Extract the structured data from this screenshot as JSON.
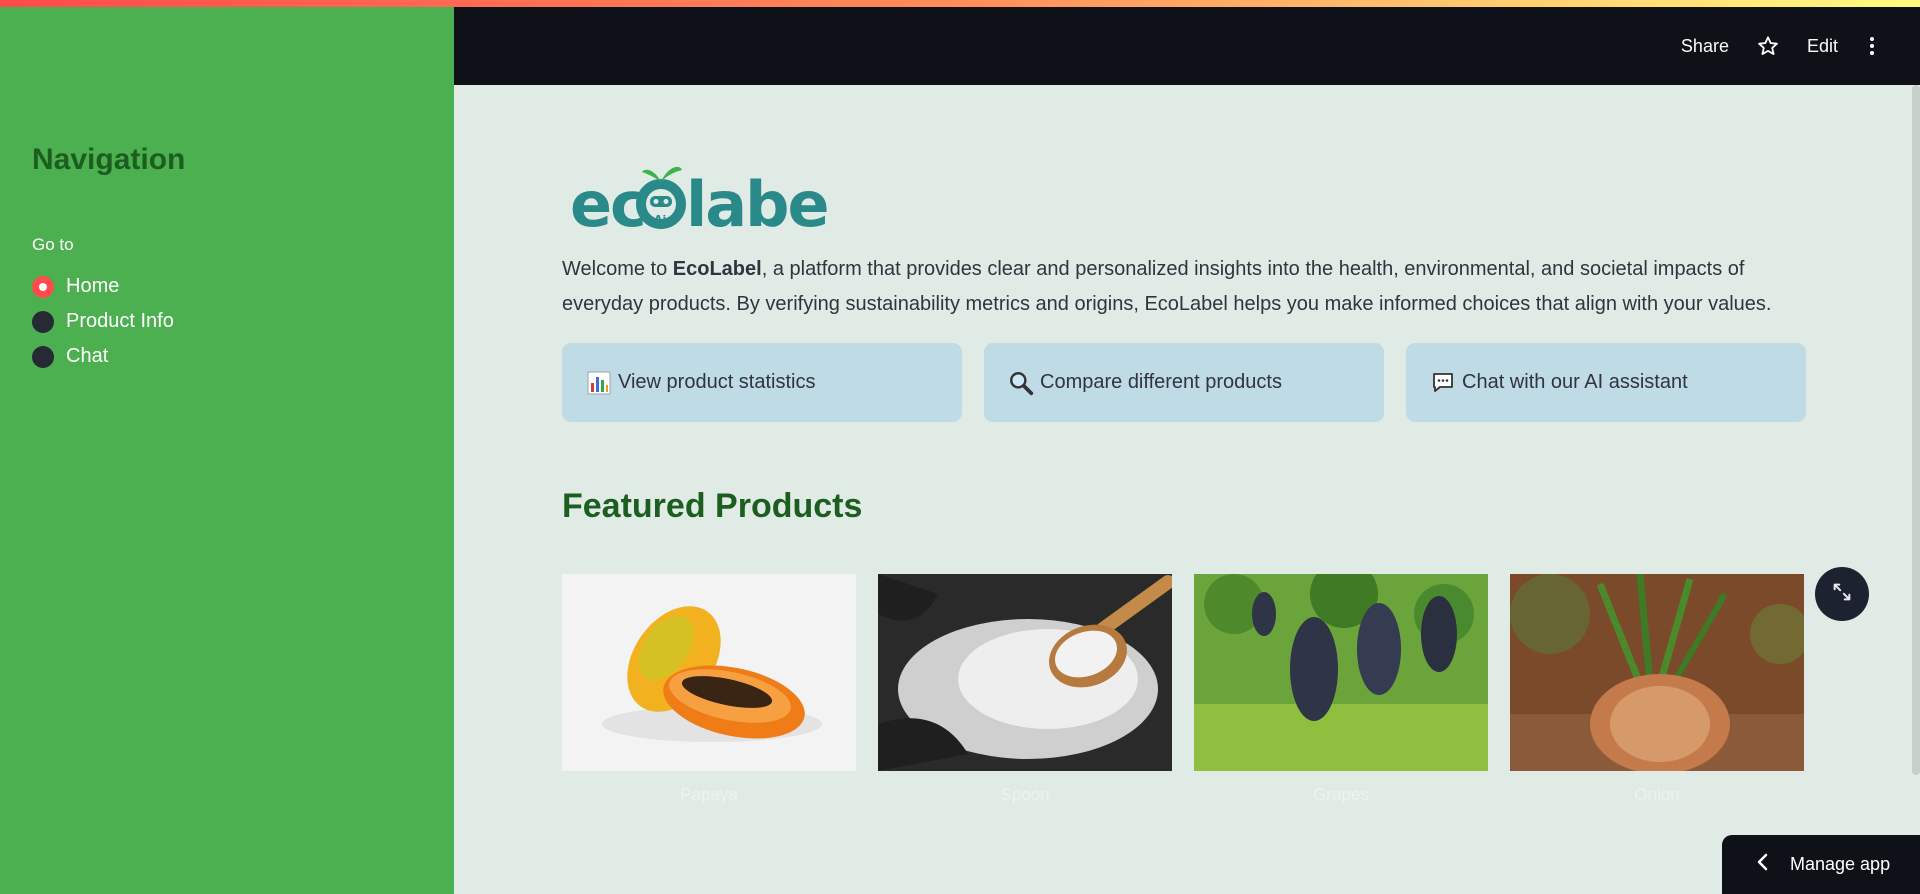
{
  "colors": {
    "sidebar_bg": "#4caf50",
    "header_bg": "#0e1117",
    "main_bg": "#e1ebe5",
    "card_bg": "#bedbe6",
    "heading_green": "#1b5e20",
    "radio_active": "#ff4b4b"
  },
  "header": {
    "share_label": "Share",
    "star_icon": "star-outline-icon",
    "edit_label": "Edit",
    "menu_icon": "kebab-menu-icon"
  },
  "sidebar": {
    "title": "Navigation",
    "goto_label": "Go to",
    "options": [
      {
        "label": "Home",
        "selected": true
      },
      {
        "label": "Product Info",
        "selected": false
      },
      {
        "label": "Chat",
        "selected": false
      }
    ]
  },
  "logo": {
    "text": "ecolabel",
    "badge": "Ai"
  },
  "intro": {
    "prefix": "Welcome to ",
    "brand": "EcoLabel",
    "text": ", a platform that provides clear and personalized insights into the health, environmental, and societal impacts of everyday products. By verifying sustainability metrics and origins, EcoLabel helps you make informed choices that align with your values."
  },
  "cards": [
    {
      "icon": "bar-chart-icon",
      "label": "View product statistics"
    },
    {
      "icon": "magnifier-icon",
      "label": "Compare different products"
    },
    {
      "icon": "speech-bubble-icon",
      "label": "Chat with our AI assistant"
    }
  ],
  "featured": {
    "title": "Featured Products",
    "products": [
      {
        "name": "Papaya"
      },
      {
        "name": "Spoon"
      },
      {
        "name": "Grapes"
      },
      {
        "name": "Onion"
      }
    ]
  },
  "footer": {
    "manage_app_label": "Manage app"
  }
}
